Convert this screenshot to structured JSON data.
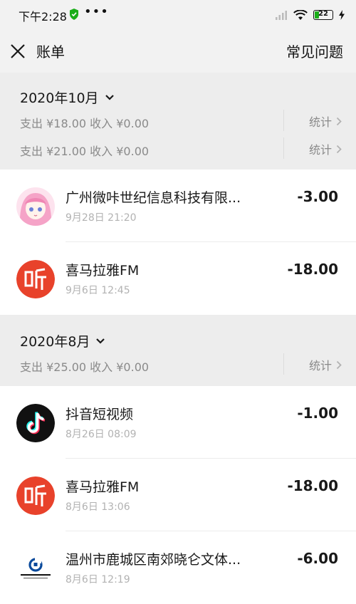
{
  "status_bar": {
    "time": "下午2:28",
    "dots": "•••",
    "battery": "22"
  },
  "navbar": {
    "title": "账单",
    "faq_label": "常见问题"
  },
  "months": [
    {
      "title": "2020年10月",
      "summaries": [
        {
          "text": "支出 ¥18.00 收入 ¥0.00",
          "stats_label": "统计"
        },
        {
          "text": "支出 ¥21.00 收入 ¥0.00",
          "stats_label": "统计"
        }
      ],
      "transactions": [
        {
          "name": "广州微咔世纪信息科技有限...",
          "time": "9月28日 21:20",
          "amount": "-3.00",
          "icon": "anime-avatar-icon"
        },
        {
          "name": "喜马拉雅FM",
          "time": "9月6日 12:45",
          "amount": "-18.00",
          "icon": "ximalaya-icon"
        }
      ]
    },
    {
      "title": "2020年8月",
      "summaries": [
        {
          "text": "支出 ¥25.00 收入 ¥0.00",
          "stats_label": "统计"
        }
      ],
      "transactions": [
        {
          "name": "抖音短视频",
          "time": "8月26日 08:09",
          "amount": "-1.00",
          "icon": "douyin-icon"
        },
        {
          "name": "喜马拉雅FM",
          "time": "8月6日 13:06",
          "amount": "-18.00",
          "icon": "ximalaya-icon"
        },
        {
          "name": "温州市鹿城区南郊晓仑文体...",
          "time": "8月6日 12:19",
          "amount": "-6.00",
          "icon": "ccb-bank-icon"
        }
      ]
    }
  ],
  "colors": {
    "header_bg": "#ededed",
    "ximalaya_red": "#e8422b",
    "douyin_bg": "#111111",
    "wechat_green": "#1aad19"
  }
}
